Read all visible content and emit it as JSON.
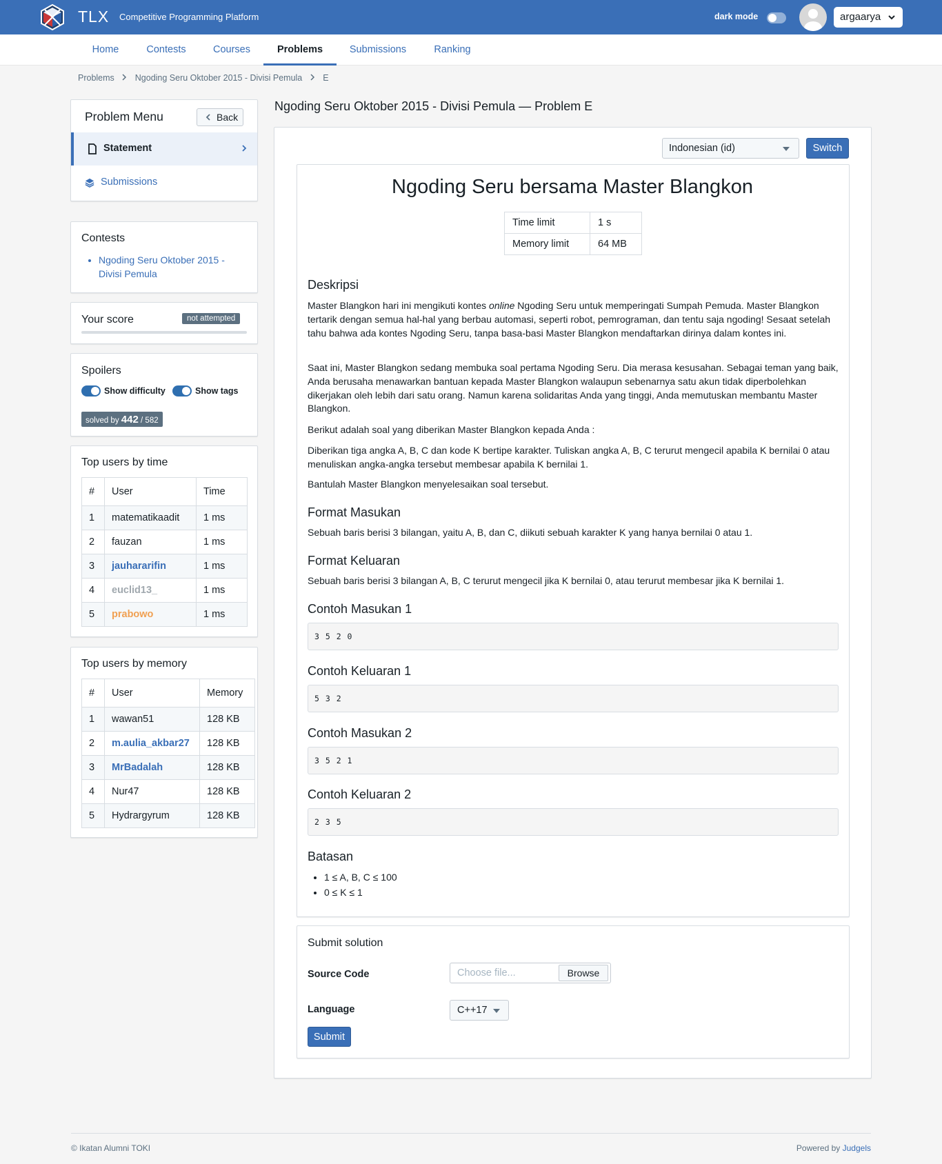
{
  "header": {
    "brand": "TLX",
    "tagline": "Competitive Programming Platform",
    "dark_mode_label": "dark mode",
    "username": "argaarya"
  },
  "nav": {
    "tabs": [
      "Home",
      "Contests",
      "Courses",
      "Problems",
      "Submissions",
      "Ranking"
    ],
    "active": "Problems"
  },
  "breadcrumb": [
    "Problems",
    "Ngoding Seru Oktober 2015 - Divisi Pemula",
    "E"
  ],
  "sidebar": {
    "problem_menu": {
      "title": "Problem Menu",
      "back_label": "Back",
      "items": [
        {
          "label": "Statement",
          "icon": "document-icon",
          "active": true
        },
        {
          "label": "Submissions",
          "icon": "layers-icon",
          "active": false
        }
      ]
    },
    "contests": {
      "title": "Contests",
      "items": [
        "Ngoding Seru Oktober 2015 - Divisi Pemula"
      ]
    },
    "score": {
      "title": "Your score",
      "badge": "not attempted"
    },
    "spoilers": {
      "title": "Spoilers",
      "show_difficulty": "Show difficulty",
      "show_tags": "Show tags",
      "solved_prefix": "solved by",
      "solved_count": "442",
      "solved_total": "/ 582"
    },
    "top_time": {
      "title": "Top users by time",
      "headers": [
        "#",
        "User",
        "Time"
      ],
      "rows": [
        {
          "rank": "1",
          "user": "matematikaadit",
          "value": "1 ms",
          "style": "plain"
        },
        {
          "rank": "2",
          "user": "fauzan",
          "value": "1 ms",
          "style": "plain"
        },
        {
          "rank": "3",
          "user": "jauhararifin",
          "value": "1 ms",
          "style": "blue"
        },
        {
          "rank": "4",
          "user": "euclid13_",
          "value": "1 ms",
          "style": "gray"
        },
        {
          "rank": "5",
          "user": "prabowo",
          "value": "1 ms",
          "style": "orange"
        }
      ]
    },
    "top_memory": {
      "title": "Top users by memory",
      "headers": [
        "#",
        "User",
        "Memory"
      ],
      "rows": [
        {
          "rank": "1",
          "user": "wawan51",
          "value": "128 KB",
          "style": "plain"
        },
        {
          "rank": "2",
          "user": "m.aulia_akbar27",
          "value": "128 KB",
          "style": "blue"
        },
        {
          "rank": "3",
          "user": "MrBadalah",
          "value": "128 KB",
          "style": "blue"
        },
        {
          "rank": "4",
          "user": "Nur47",
          "value": "128 KB",
          "style": "plain"
        },
        {
          "rank": "5",
          "user": "Hydrargyrum",
          "value": "128 KB",
          "style": "plain"
        }
      ]
    }
  },
  "main": {
    "title": "Ngoding Seru Oktober 2015 - Divisi Pemula — Problem E",
    "language_select": "Indonesian (id)",
    "switch_label": "Switch",
    "statement_title": "Ngoding Seru bersama Master Blangkon",
    "limits": [
      {
        "label": "Time limit",
        "value": "1 s"
      },
      {
        "label": "Memory limit",
        "value": "64 MB"
      }
    ],
    "description_heading": "Deskripsi",
    "desc_p1_a": "Master Blangkon hari ini mengikuti kontes ",
    "desc_p1_em": "online",
    "desc_p1_b": " Ngoding Seru untuk memperingati Sumpah Pemuda. Master Blangkon tertarik dengan semua hal-hal yang berbau automasi, seperti robot, pemrograman, dan tentu saja ngoding! Sesaat setelah tahu bahwa ada kontes Ngoding Seru, tanpa basa-basi Master Blangkon mendaftarkan dirinya dalam kontes ini.",
    "desc_p2": "Saat ini, Master Blangkon sedang membuka soal pertama Ngoding Seru. Dia merasa kesusahan. Sebagai teman yang baik, Anda berusaha menawarkan bantuan kepada Master Blangkon walaupun sebenarnya satu akun tidak diperbolehkan dikerjakan oleh lebih dari satu orang. Namun karena solidaritas Anda yang tinggi, Anda memutuskan membantu Master Blangkon.",
    "desc_p3": "Berikut adalah soal yang diberikan Master Blangkon kepada Anda :",
    "desc_p4": "Diberikan tiga angka A, B, C dan kode K bertipe karakter. Tuliskan angka A, B, C terurut mengecil apabila K bernilai 0 atau menuliskan angka-angka tersebut membesar apabila K bernilai 1.",
    "desc_p5": "Bantulah Master Blangkon menyelesaikan soal tersebut.",
    "input_heading": "Format Masukan",
    "input_text": "Sebuah baris berisi 3 bilangan, yaitu A, B, dan C, diikuti sebuah karakter K yang hanya bernilai 0 atau 1.",
    "output_heading": "Format Keluaran",
    "output_text": "Sebuah baris berisi 3 bilangan A, B, C terurut mengecil jika K bernilai 0, atau terurut membesar jika K bernilai 1.",
    "samples": [
      {
        "heading": "Contoh Masukan 1",
        "content": "3 5 2 0"
      },
      {
        "heading": "Contoh Keluaran 1",
        "content": "5 3 2"
      },
      {
        "heading": "Contoh Masukan 2",
        "content": "3 5 2 1"
      },
      {
        "heading": "Contoh Keluaran 2",
        "content": "2 3 5"
      }
    ],
    "constraints_heading": "Batasan",
    "constraints": [
      "1 ≤ A, B, C ≤ 100",
      "0 ≤ K ≤ 1"
    ],
    "submit": {
      "title": "Submit solution",
      "source_label": "Source Code",
      "file_placeholder": "Choose file...",
      "browse_label": "Browse",
      "language_label": "Language",
      "language_value": "C++17",
      "submit_label": "Submit"
    }
  },
  "footer": {
    "left": "© Ikatan Alumni TOKI",
    "right_prefix": "Powered by",
    "right_link": "Judgels"
  },
  "colors": {
    "brand_blue": "#3a6fb7",
    "badge_gray": "#5c7080",
    "user_orange": "#f0a052",
    "user_gray": "#a0a8ae"
  }
}
